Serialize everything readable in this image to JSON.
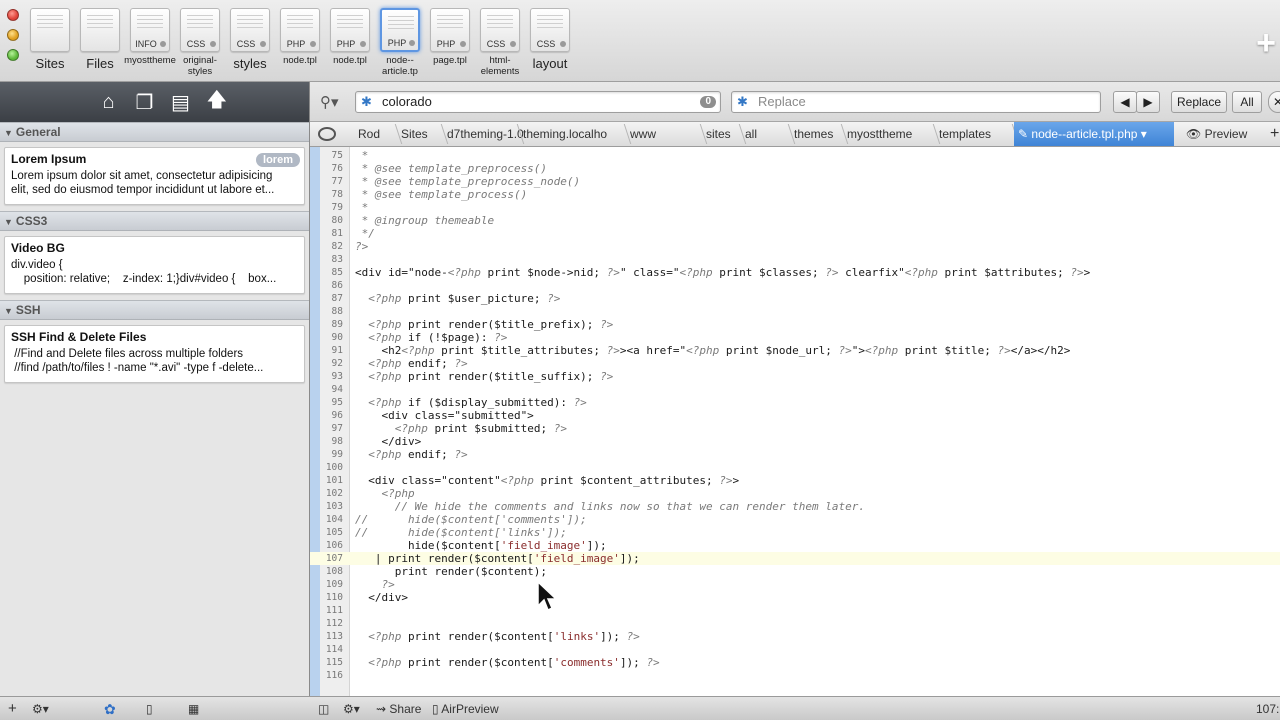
{
  "toolbar": {
    "items": [
      {
        "caption": "Sites",
        "type": "",
        "big": true
      },
      {
        "caption": "Files",
        "type": "",
        "big": true
      },
      {
        "caption": "myosttheme",
        "type": "INFO"
      },
      {
        "caption": "original-styles",
        "type": "CSS"
      },
      {
        "caption": "styles",
        "type": "CSS",
        "big": true
      },
      {
        "caption": "node.tpl",
        "type": "PHP"
      },
      {
        "caption": "node.tpl",
        "type": "PHP"
      },
      {
        "caption": "node--article.tp",
        "type": "PHP",
        "selected": true
      },
      {
        "caption": "page.tpl",
        "type": "PHP"
      },
      {
        "caption": "html-elements",
        "type": "CSS"
      },
      {
        "caption": "layout",
        "type": "CSS",
        "big": true
      }
    ]
  },
  "sidebar": {
    "categories": [
      {
        "name": "General",
        "clips": [
          {
            "title": "Lorem Ipsum",
            "badge": "lorem",
            "body": "Lorem ipsum dolor sit amet, consectetur adipisicing\nelit, sed do eiusmod tempor incididunt ut labore et..."
          }
        ]
      },
      {
        "name": "CSS3",
        "clips": [
          {
            "title": "Video BG",
            "badge": "",
            "body": "div.video {\n    position: relative;    z-index: 1;}div#video {    box..."
          }
        ]
      },
      {
        "name": "SSH",
        "clips": [
          {
            "title": "SSH Find & Delete Files",
            "badge": "",
            "body": " //Find and Delete files across multiple folders\n //find /path/to/files ! -name \"*.avi\" -type f -delete..."
          }
        ]
      }
    ]
  },
  "search": {
    "value": "colorado",
    "count": "0",
    "replace_placeholder": "Replace",
    "replace_label": "Replace",
    "all_label": "All"
  },
  "breadcrumbs": [
    "Rod",
    "Sites",
    "d7theming-1.0",
    "theming.localho",
    "www",
    "sites",
    "all",
    "themes",
    "myosttheme",
    "templates",
    "node--article.tpl.php"
  ],
  "preview_label": "Preview",
  "editor": {
    "current_line": 107,
    "lines": [
      {
        "n": "75",
        "t": " *"
      },
      {
        "n": "76",
        "t": " * @see template_preprocess()"
      },
      {
        "n": "77",
        "t": " * @see template_preprocess_node()"
      },
      {
        "n": "78",
        "t": " * @see template_process()"
      },
      {
        "n": "79",
        "t": " *"
      },
      {
        "n": "80",
        "t": " * @ingroup themeable"
      },
      {
        "n": "81",
        "t": " */"
      },
      {
        "n": "82",
        "t": "?>"
      },
      {
        "n": "83",
        "t": ""
      },
      {
        "n": "85",
        "t": "<div id=\"node-<?php print $node->nid; ?>\" class=\"<?php print $classes; ?> clearfix\"<?php print $attributes; ?>>"
      },
      {
        "n": "86",
        "t": ""
      },
      {
        "n": "87",
        "t": "  <?php print $user_picture; ?>"
      },
      {
        "n": "88",
        "t": ""
      },
      {
        "n": "89",
        "t": "  <?php print render($title_prefix); ?>"
      },
      {
        "n": "90",
        "t": "  <?php if (!$page): ?>"
      },
      {
        "n": "91",
        "t": "    <h2<?php print $title_attributes; ?>><a href=\"<?php print $node_url; ?>\"><?php print $title; ?></a></h2>"
      },
      {
        "n": "92",
        "t": "  <?php endif; ?>"
      },
      {
        "n": "93",
        "t": "  <?php print render($title_suffix); ?>"
      },
      {
        "n": "94",
        "t": ""
      },
      {
        "n": "95",
        "t": "  <?php if ($display_submitted): ?>"
      },
      {
        "n": "96",
        "t": "    <div class=\"submitted\">"
      },
      {
        "n": "97",
        "t": "      <?php print $submitted; ?>"
      },
      {
        "n": "98",
        "t": "    </div>"
      },
      {
        "n": "99",
        "t": "  <?php endif; ?>"
      },
      {
        "n": "100",
        "t": ""
      },
      {
        "n": "101",
        "t": "  <div class=\"content\"<?php print $content_attributes; ?>>"
      },
      {
        "n": "102",
        "t": "    <?php"
      },
      {
        "n": "103",
        "t": "      // We hide the comments and links now so that we can render them later."
      },
      {
        "n": "104",
        "t": "//      hide($content['comments']);"
      },
      {
        "n": "105",
        "t": "//      hide($content['links']);"
      },
      {
        "n": "106",
        "t": "        hide($content['field_image']);"
      },
      {
        "n": "107",
        "t": "   | print render($content['field_image']);"
      },
      {
        "n": "108",
        "t": "      print render($content);"
      },
      {
        "n": "109",
        "t": "    ?>"
      },
      {
        "n": "110",
        "t": "  </div>"
      },
      {
        "n": "111",
        "t": ""
      },
      {
        "n": "112",
        "t": ""
      },
      {
        "n": "113",
        "t": "  <?php print render($content['links']); ?>"
      },
      {
        "n": "114",
        "t": ""
      },
      {
        "n": "115",
        "t": "  <?php print render($content['comments']); ?>"
      },
      {
        "n": "116",
        "t": ""
      }
    ]
  },
  "statusbar": {
    "share": "Share",
    "airpreview": "AirPreview",
    "position": "107:"
  }
}
